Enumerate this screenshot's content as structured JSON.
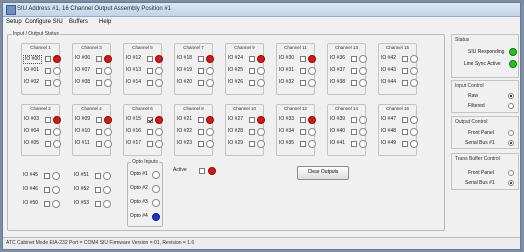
{
  "window": {
    "title": "SIU Address #1, 16 Channel Output Assembly Position #1"
  },
  "menu": [
    "Setup",
    "Configure SIU",
    "Buffers",
    "Help"
  ],
  "io_status": {
    "group_label": "Input / Output Status",
    "channels_top": [
      {
        "label": "Channel 1",
        "io": [
          {
            "name": "IO #00",
            "checked": false,
            "state": "red",
            "boxed": true
          },
          {
            "name": "IO #01",
            "checked": false,
            "state": "off"
          },
          {
            "name": "IO #02",
            "checked": false,
            "state": "off"
          }
        ]
      },
      {
        "label": "Channel 3",
        "io": [
          {
            "name": "IO #06",
            "checked": false,
            "state": "red"
          },
          {
            "name": "IO #07",
            "checked": false,
            "state": "off"
          },
          {
            "name": "IO #08",
            "checked": false,
            "state": "off"
          }
        ]
      },
      {
        "label": "Channel 5",
        "io": [
          {
            "name": "IO #12",
            "checked": false,
            "state": "red"
          },
          {
            "name": "IO #13",
            "checked": false,
            "state": "off"
          },
          {
            "name": "IO #14",
            "checked": false,
            "state": "off"
          }
        ]
      },
      {
        "label": "Channel 7",
        "io": [
          {
            "name": "IO #18",
            "checked": false,
            "state": "red"
          },
          {
            "name": "IO #19",
            "checked": false,
            "state": "off"
          },
          {
            "name": "IO #20",
            "checked": false,
            "state": "off"
          }
        ]
      },
      {
        "label": "Channel 9",
        "io": [
          {
            "name": "IO #24",
            "checked": false,
            "state": "red"
          },
          {
            "name": "IO #25",
            "checked": false,
            "state": "off"
          },
          {
            "name": "IO #26",
            "checked": false,
            "state": "off"
          }
        ]
      },
      {
        "label": "Channel 11",
        "io": [
          {
            "name": "IO #30",
            "checked": false,
            "state": "red"
          },
          {
            "name": "IO #31",
            "checked": false,
            "state": "off"
          },
          {
            "name": "IO #32",
            "checked": false,
            "state": "off"
          }
        ]
      },
      {
        "label": "Channel 13",
        "io": [
          {
            "name": "IO #36",
            "checked": false,
            "state": "off"
          },
          {
            "name": "IO #37",
            "checked": false,
            "state": "off"
          },
          {
            "name": "IO #38",
            "checked": false,
            "state": "off"
          }
        ]
      },
      {
        "label": "Channel 15",
        "io": [
          {
            "name": "IO #42",
            "checked": false,
            "state": "off"
          },
          {
            "name": "IO #43",
            "checked": false,
            "state": "off"
          },
          {
            "name": "IO #44",
            "checked": false,
            "state": "off"
          }
        ]
      }
    ],
    "channels_bottom": [
      {
        "label": "Channel 2",
        "io": [
          {
            "name": "IO #03",
            "checked": false,
            "state": "red"
          },
          {
            "name": "IO #04",
            "checked": false,
            "state": "off"
          },
          {
            "name": "IO #05",
            "checked": false,
            "state": "off"
          }
        ]
      },
      {
        "label": "Channel 4",
        "io": [
          {
            "name": "IO #09",
            "checked": false,
            "state": "red"
          },
          {
            "name": "IO #10",
            "checked": false,
            "state": "off"
          },
          {
            "name": "IO #11",
            "checked": false,
            "state": "off"
          }
        ]
      },
      {
        "label": "Channel 6",
        "io": [
          {
            "name": "IO #15",
            "checked": true,
            "state": "red"
          },
          {
            "name": "IO #16",
            "checked": false,
            "state": "off"
          },
          {
            "name": "IO #17",
            "checked": false,
            "state": "off"
          }
        ]
      },
      {
        "label": "Channel 8",
        "io": [
          {
            "name": "IO #21",
            "checked": false,
            "state": "red"
          },
          {
            "name": "IO #22",
            "checked": false,
            "state": "off"
          },
          {
            "name": "IO #23",
            "checked": false,
            "state": "off"
          }
        ]
      },
      {
        "label": "Channel 10",
        "io": [
          {
            "name": "IO #27",
            "checked": false,
            "state": "red"
          },
          {
            "name": "IO #28",
            "checked": false,
            "state": "off"
          },
          {
            "name": "IO #29",
            "checked": false,
            "state": "off"
          }
        ]
      },
      {
        "label": "Channel 12",
        "io": [
          {
            "name": "IO #33",
            "checked": false,
            "state": "red"
          },
          {
            "name": "IO #34",
            "checked": false,
            "state": "off"
          },
          {
            "name": "IO #35",
            "checked": false,
            "state": "off"
          }
        ]
      },
      {
        "label": "Channel 14",
        "io": [
          {
            "name": "IO #39",
            "checked": false,
            "state": "off"
          },
          {
            "name": "IO #40",
            "checked": false,
            "state": "off"
          },
          {
            "name": "IO #41",
            "checked": false,
            "state": "off"
          }
        ]
      },
      {
        "label": "Channel 16",
        "io": [
          {
            "name": "IO #47",
            "checked": false,
            "state": "off"
          },
          {
            "name": "IO #48",
            "checked": false,
            "state": "off"
          },
          {
            "name": "IO #49",
            "checked": false,
            "state": "off"
          }
        ]
      }
    ],
    "extra_io": [
      [
        {
          "name": "IO #45",
          "checked": false,
          "state": "off"
        },
        {
          "name": "IO #51",
          "checked": false,
          "state": "off"
        }
      ],
      [
        {
          "name": "IO #46",
          "checked": false,
          "state": "off"
        },
        {
          "name": "IO #52",
          "checked": false,
          "state": "off"
        }
      ],
      [
        {
          "name": "IO #50",
          "checked": false,
          "state": "off"
        },
        {
          "name": "IO #53",
          "checked": false,
          "state": "off"
        }
      ]
    ],
    "opto": {
      "label": "Opto Inputs",
      "items": [
        {
          "name": "Opto #1",
          "state": "off"
        },
        {
          "name": "Opto #2",
          "state": "off"
        },
        {
          "name": "Opto #3",
          "state": "off"
        },
        {
          "name": "Opto #4",
          "state": "blue"
        }
      ]
    },
    "active": {
      "label": "Active",
      "checked": false,
      "state": "red"
    },
    "clear_button": "Clear Outputs"
  },
  "status": {
    "title": "Status",
    "items": [
      {
        "label": "SIU Responding",
        "state": "green"
      },
      {
        "label": "Line Sync Active",
        "state": "green"
      }
    ]
  },
  "input_control": {
    "title": "Input Control",
    "options": [
      {
        "label": "Raw",
        "selected": true
      },
      {
        "label": "Filtered",
        "selected": false
      }
    ]
  },
  "output_control": {
    "title": "Output Control",
    "options": [
      {
        "label": "Front Panel",
        "selected": false
      },
      {
        "label": "Serial Bus #1",
        "selected": true
      }
    ]
  },
  "trans_buffer_control": {
    "title": "Trans Buffer Control",
    "options": [
      {
        "label": "Front Panel",
        "selected": false
      },
      {
        "label": "Serial Bus #1",
        "selected": true
      }
    ]
  },
  "statusbar": {
    "text": "ATC Cabinet Mode   EIA-232 Port = COM4  SIU Firmware Version = 01, Revision = 1.6"
  },
  "colors": {
    "on_red": "#e01414",
    "on_blue": "#1a2fd8",
    "on_green": "#24c41f",
    "window_bg": "#f0f0f0"
  }
}
